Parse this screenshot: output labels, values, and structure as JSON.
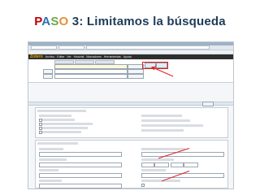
{
  "slide": {
    "title_paso_letters": [
      "P",
      "A",
      "S",
      "O"
    ],
    "title_rest": " 3: Limitamos la búsqueda"
  },
  "app": {
    "logo": "Zotero",
    "menu": [
      "Archivo",
      "Editar",
      "Ver",
      "Historial",
      "Marcadores",
      "Herramientas",
      "Ayuda"
    ],
    "colors": {
      "highlight": "#e02020",
      "menubar": "#2e2e2e",
      "logo": "#f2a900"
    }
  }
}
